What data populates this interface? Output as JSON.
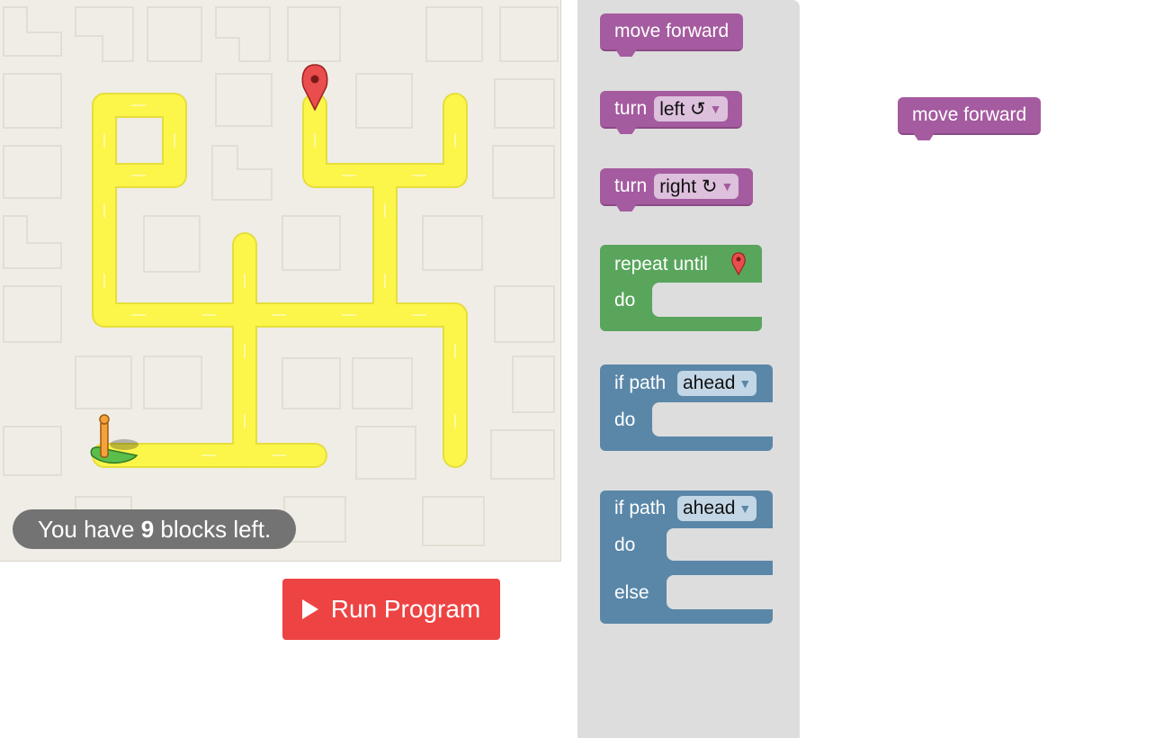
{
  "maze": {
    "capacity": {
      "prefix": "You have ",
      "count": "9",
      "suffix": " blocks left."
    }
  },
  "run_button": {
    "label": "Run Program"
  },
  "toolbox": {
    "move_forward": {
      "label": "move forward"
    },
    "turn_left": {
      "label": "turn",
      "option": "left ↺"
    },
    "turn_right": {
      "label": "turn",
      "option": "right ↻"
    },
    "repeat_until": {
      "label": "repeat until",
      "do": "do"
    },
    "if_path": {
      "label": "if path",
      "option": "ahead",
      "do": "do"
    },
    "if_else": {
      "label": "if path",
      "option": "ahead",
      "do": "do",
      "else": "else"
    }
  },
  "workspace": {
    "blocks": [
      {
        "label": "move forward"
      }
    ]
  },
  "colors": {
    "logic_purple": "#a55b9f",
    "loop_green": "#58a55b",
    "if_blue": "#5a87a8",
    "path_yellow": "#fcf54a",
    "run_red": "#ee4343"
  },
  "icons": {
    "goal": "map-pin-icon",
    "player": "pegman-icon",
    "play": "play-icon"
  }
}
